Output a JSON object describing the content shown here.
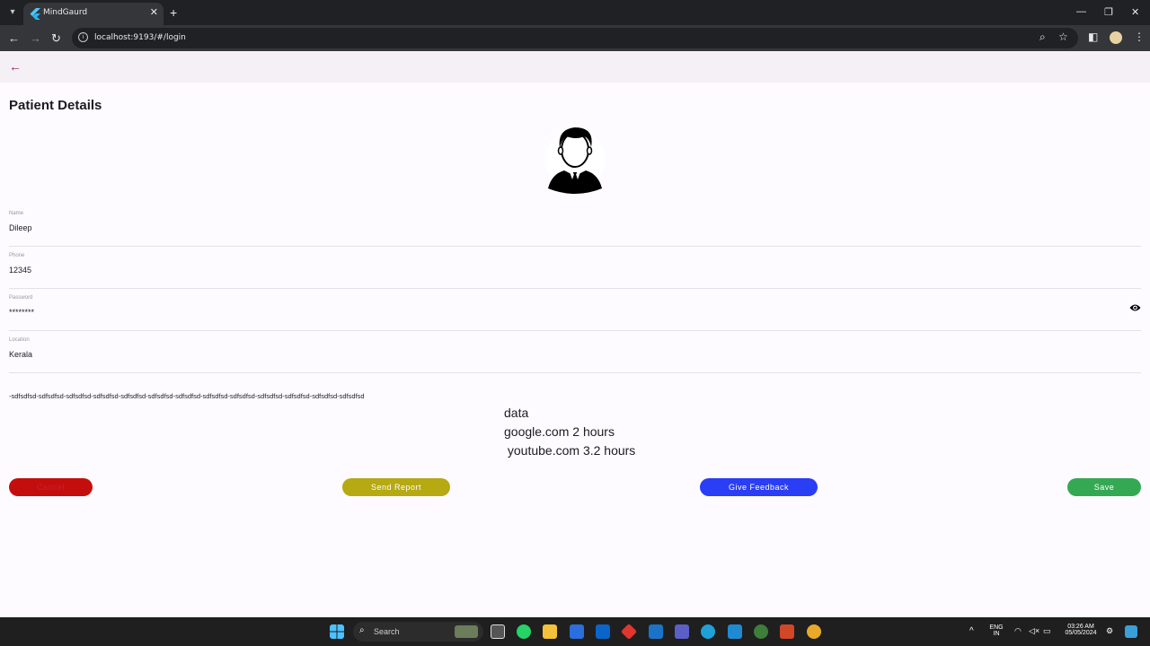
{
  "browser": {
    "tab_title": "MindGaurd",
    "tab_close": "✕",
    "new_tab": "+",
    "url": "localhost:9193/#/login",
    "minimize": "—",
    "restore": "❐",
    "close": "✕"
  },
  "app": {
    "page_title": "Patient Details"
  },
  "form": {
    "name_label": "Name",
    "name_value": "Dileep",
    "phone_label": "Phone",
    "phone_value": "12345",
    "password_label": "Password",
    "password_value": "********",
    "location_label": "Location",
    "location_value": "Kerala"
  },
  "content": {
    "long_text": "-sdfsdfsd-sdfsdfsd-sdfsdfsd-sdfsdfsd-sdfsdfsd-sdfsdfsd-sdfsdfsd-sdfsdfsd-sdfsdfsd-sdfsdfsd-sdfsdfsd-sdfsdfsd-sdfsdfsd",
    "data_text": "data\ngoogle.com 2 hours\n youtube.com 3.2 hours"
  },
  "buttons": {
    "cancel": "Cancel",
    "send_report": "Send Report",
    "give_feedback": "Give Feedback",
    "save": "Save"
  },
  "colors": {
    "cancel": "#c40e0e",
    "send_report": "#b6a911",
    "give_feedback": "#2a3ef5",
    "save": "#35a853",
    "accent": "#8a1c74"
  },
  "taskbar": {
    "search_label": "Search",
    "lang_top": "ENG",
    "lang_bottom": "IN",
    "time": "03:26 AM",
    "date": "05/05/2024"
  }
}
